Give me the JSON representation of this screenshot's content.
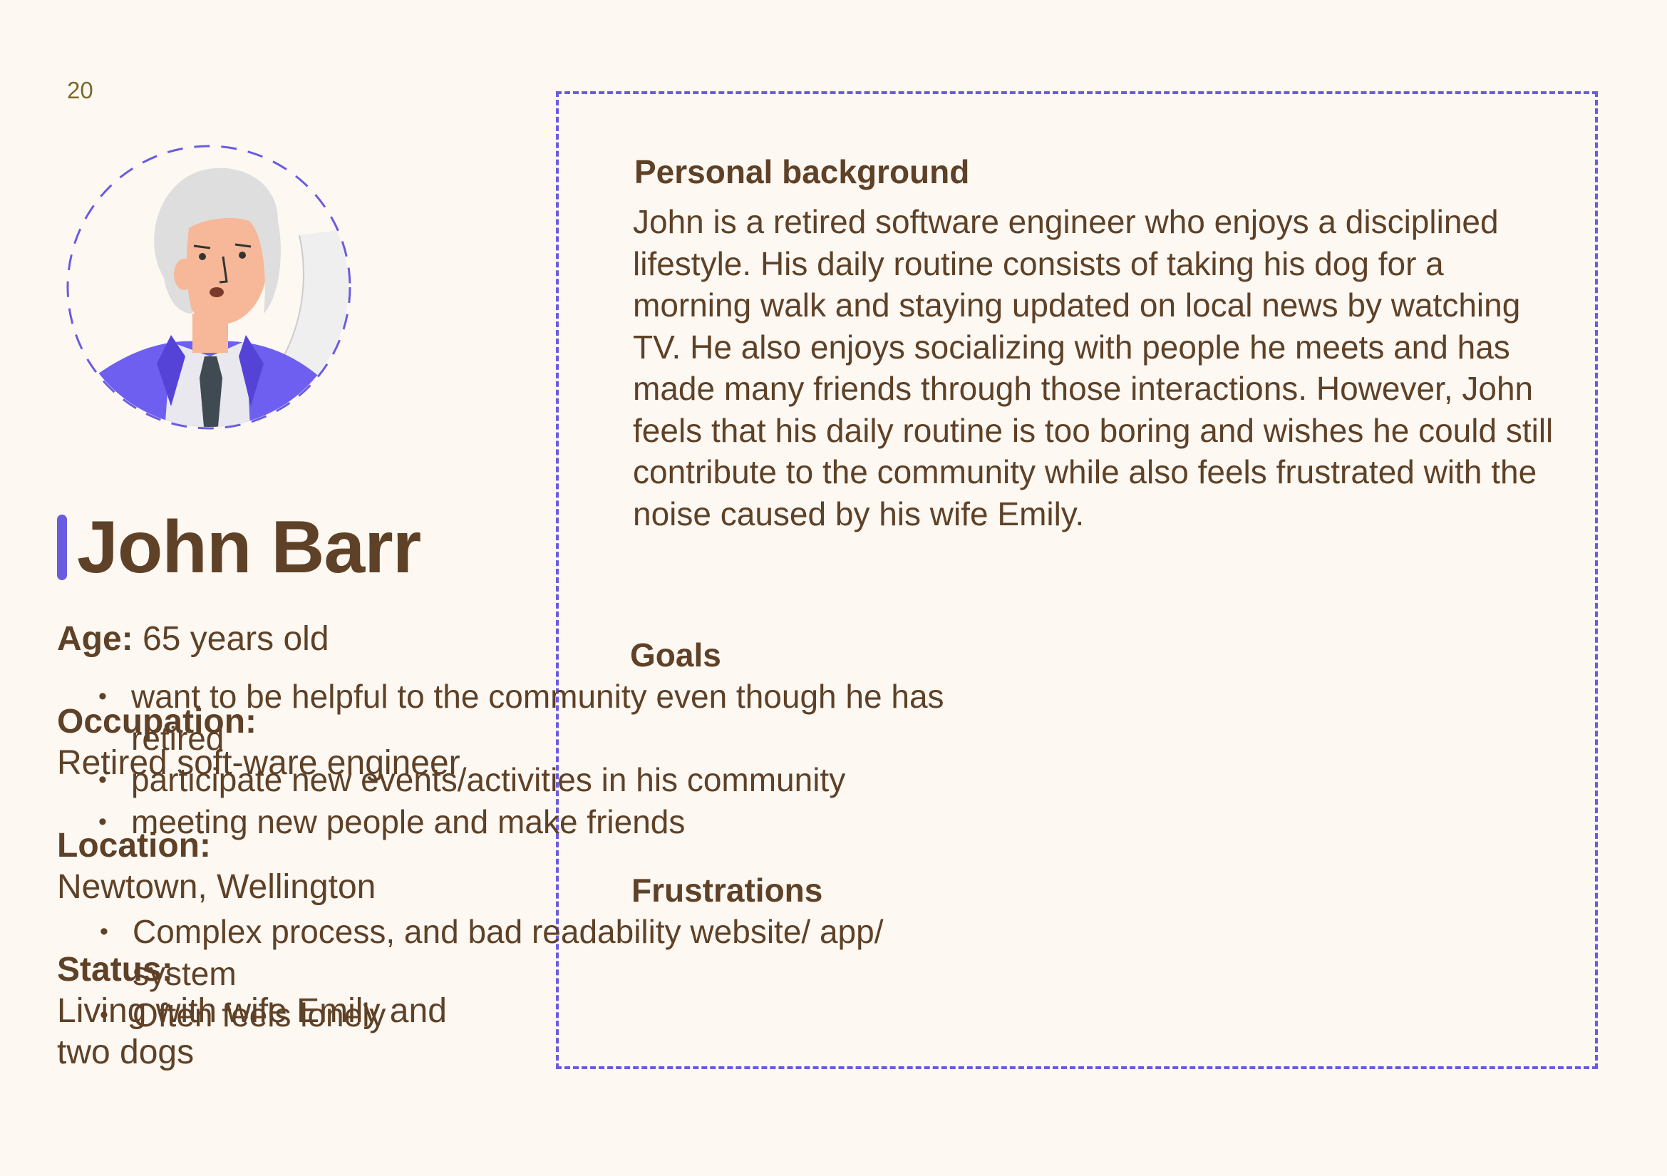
{
  "page_number": "20",
  "persona": {
    "name": "John Barr",
    "age_label": "Age:",
    "age_value": "65 years old",
    "occupation_label": "Occupation:",
    "occupation_value": "Retired soft-ware engineer",
    "location_label": "Location:",
    "location_value": "Newtown, Wellington",
    "status_label": "Status:",
    "status_value": "Living with wife Emily and two dogs"
  },
  "background": {
    "title": "Personal background",
    "text": "John is a retired software engineer who enjoys a disciplined lifestyle. His daily routine consists of taking his dog for a morning walk and staying updated on local news by watching TV. He also enjoys socializing with people he meets and has made many friends through those interactions. However, John feels that his daily routine is too boring and wishes he could still contribute to the community while also feels frustrated with the noise caused by his wife Emily."
  },
  "goals": {
    "title": "Goals",
    "items": [
      "want to be helpful to the community even though he has retired",
      "participate new events/activities in his community",
      "meeting new people and make friends"
    ]
  },
  "frustrations": {
    "title": "Frustrations",
    "items": [
      "Complex process, and bad readability website/ app/ system",
      "Often feels lonely"
    ]
  },
  "colors": {
    "accent": "#6a5ce0",
    "text": "#5e4127",
    "background": "#fdf8f2"
  },
  "icons": {
    "avatar": "elderly-man-avatar-icon"
  }
}
